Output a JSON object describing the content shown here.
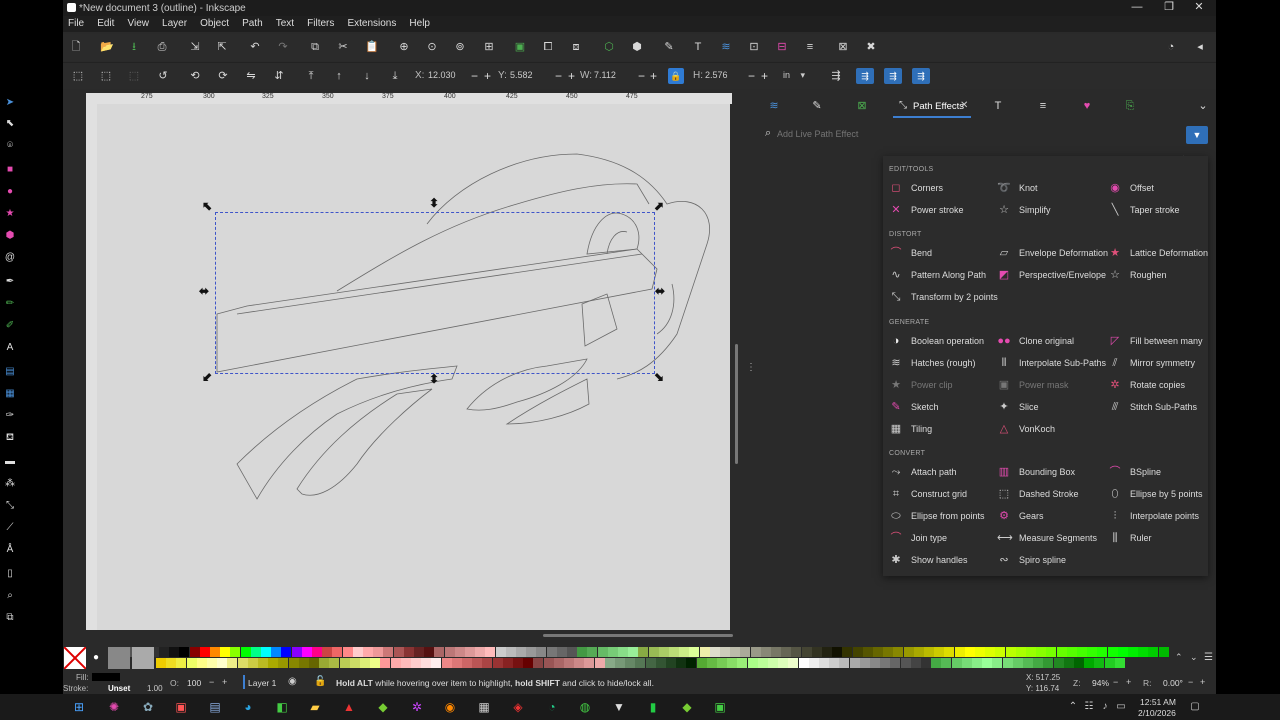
{
  "window": {
    "title": "*New document 3 (outline) - Inkscape",
    "minimize": "—",
    "restore": "❐",
    "close": "✕"
  },
  "menu": [
    "File",
    "Edit",
    "View",
    "Layer",
    "Object",
    "Path",
    "Text",
    "Filters",
    "Extensions",
    "Help"
  ],
  "controls": {
    "x_label": "X:",
    "x_value": "12.030",
    "y_label": "Y:",
    "y_value": "5.582",
    "w_label": "W:",
    "w_value": "7.112",
    "h_label": "H:",
    "h_value": "2.576",
    "unit": "in"
  },
  "ruler_ticks": [
    "275",
    "300",
    "325",
    "350",
    "375",
    "400",
    "425",
    "450",
    "475"
  ],
  "dock": {
    "active_tab": "Path Effects",
    "search_placeholder": "Add Live Path Effect"
  },
  "effects": {
    "edit_tools": {
      "heading": "EDIT/TOOLS",
      "items": [
        {
          "label": "Corners",
          "icon": "◻",
          "color": "#e0507a"
        },
        {
          "label": "Knot",
          "icon": "➰",
          "color": "#ccc"
        },
        {
          "label": "Offset",
          "icon": "◉",
          "color": "#e44bb0"
        },
        {
          "label": "Power stroke",
          "icon": "✕",
          "color": "#e44bb0"
        },
        {
          "label": "Simplify",
          "icon": "☆",
          "color": "#ccc"
        },
        {
          "label": "Taper stroke",
          "icon": "╲",
          "color": "#ccc"
        }
      ]
    },
    "distort": {
      "heading": "DISTORT",
      "items": [
        {
          "label": "Bend",
          "icon": "⌒",
          "color": "#e0507a"
        },
        {
          "label": "Envelope Deformation",
          "icon": "▱",
          "color": "#ccc"
        },
        {
          "label": "Lattice Deformation",
          "icon": "★",
          "color": "#e0507a"
        },
        {
          "label": "Pattern Along Path",
          "icon": "∿",
          "color": "#ccc"
        },
        {
          "label": "Perspective/Envelope",
          "icon": "◩",
          "color": "#e44bb0"
        },
        {
          "label": "Roughen",
          "icon": "☆",
          "color": "#ccc"
        },
        {
          "label": "Transform by 2 points",
          "icon": "⤡",
          "color": "#ccc"
        }
      ]
    },
    "generate": {
      "heading": "GENERATE",
      "items": [
        {
          "label": "Boolean operation",
          "icon": "◑",
          "color": "#eee",
          "dim": false
        },
        {
          "label": "Clone original",
          "icon": "●●",
          "color": "#e44bb0",
          "dim": false
        },
        {
          "label": "Fill between many",
          "icon": "◸",
          "color": "#e44bb0",
          "dim": false
        },
        {
          "label": "Hatches (rough)",
          "icon": "≋",
          "color": "#ccc",
          "dim": false
        },
        {
          "label": "Interpolate Sub-Paths",
          "icon": "⦀",
          "color": "#ccc",
          "dim": false
        },
        {
          "label": "Mirror symmetry",
          "icon": "⫽",
          "color": "#ccc",
          "dim": false
        },
        {
          "label": "Power clip",
          "icon": "★",
          "color": "#777",
          "dim": true
        },
        {
          "label": "Power mask",
          "icon": "▣",
          "color": "#777",
          "dim": true
        },
        {
          "label": "Rotate copies",
          "icon": "✲",
          "color": "#e0507a",
          "dim": false
        },
        {
          "label": "Sketch",
          "icon": "✎",
          "color": "#e44bb0",
          "dim": false
        },
        {
          "label": "Slice",
          "icon": "✦",
          "color": "#ccc",
          "dim": false
        },
        {
          "label": "Stitch Sub-Paths",
          "icon": "⫻",
          "color": "#ccc",
          "dim": false
        },
        {
          "label": "Tiling",
          "icon": "▦",
          "color": "#ccc",
          "dim": false
        },
        {
          "label": "VonKoch",
          "icon": "△",
          "color": "#e0507a",
          "dim": false
        }
      ]
    },
    "convert": {
      "heading": "CONVERT",
      "items": [
        {
          "label": "Attach path",
          "icon": "⤳",
          "color": "#ccc"
        },
        {
          "label": "Bounding Box",
          "icon": "▥",
          "color": "#e44bb0"
        },
        {
          "label": "BSpline",
          "icon": "⌒",
          "color": "#e44bb0"
        },
        {
          "label": "Construct grid",
          "icon": "⌗",
          "color": "#ccc"
        },
        {
          "label": "Dashed Stroke",
          "icon": "⬚",
          "color": "#ccc"
        },
        {
          "label": "Ellipse by 5 points",
          "icon": "⬯",
          "color": "#ccc"
        },
        {
          "label": "Ellipse from points",
          "icon": "⬭",
          "color": "#ccc"
        },
        {
          "label": "Gears",
          "icon": "⚙",
          "color": "#e44bb0"
        },
        {
          "label": "Interpolate points",
          "icon": "⫶",
          "color": "#ccc"
        },
        {
          "label": "Join type",
          "icon": "⌒",
          "color": "#e0507a"
        },
        {
          "label": "Measure Segments",
          "icon": "⟷",
          "color": "#ccc"
        },
        {
          "label": "Ruler",
          "icon": "⫼",
          "color": "#ccc"
        },
        {
          "label": "Show handles",
          "icon": "✱",
          "color": "#ccc"
        },
        {
          "label": "Spiro spline",
          "icon": "∾",
          "color": "#ccc"
        }
      ]
    }
  },
  "status": {
    "fill_label": "Fill:",
    "stroke_label": "Stroke:",
    "stroke_value": "Unset",
    "stroke_width": "1.00",
    "opacity_label": "O:",
    "opacity_value": "100",
    "layer": "Layer 1",
    "message_pre": "Hold ALT",
    "message_mid1": " while hovering over item to highlight, ",
    "message_bold": "hold SHIFT",
    "message_post": " and click to hide/lock all.",
    "cursor_x": "X: 517.25",
    "cursor_y": "Y: 116.74",
    "zoom_label": "Z:",
    "zoom": "94%",
    "rotation_label": "R:",
    "rotation": "0.00°"
  },
  "taskbar": {
    "time": "12:51 AM",
    "date": "2/10/2026"
  },
  "colors": {
    "accent": "#2f6fb8",
    "pink": "#e44bb0"
  }
}
